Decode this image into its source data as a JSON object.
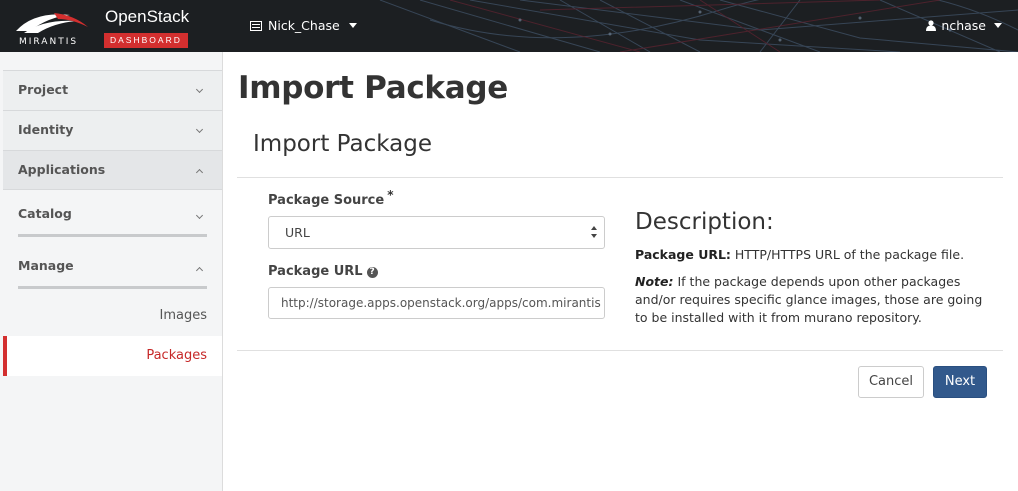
{
  "topbar": {
    "logo_openstack": "OpenStack",
    "logo_dashboard": "DASHBOARD",
    "logo_mirantis": "MIRANTIS",
    "project": "Nick_Chase",
    "user": "nchase"
  },
  "sidebar": {
    "project": "Project",
    "identity": "Identity",
    "applications": "Applications",
    "catalog": "Catalog",
    "manage": "Manage",
    "images": "Images",
    "packages": "Packages"
  },
  "main": {
    "page_title": "Import Package",
    "modal_title": "Import Package",
    "package_source_label": "Package Source",
    "required_mark": "*",
    "package_source_value": "URL",
    "package_url_label": "Package URL",
    "package_url_value": "http://storage.apps.openstack.org/apps/com.mirantis",
    "description_title": "Description:",
    "desc_url_term": "Package URL:",
    "desc_url_text": " HTTP/HTTPS URL of the package file.",
    "desc_note_term": "Note:",
    "desc_note_text": " If the package depends upon other packages and/or requires specific glance images, those are going to be installed with it from murano repository.",
    "cancel_label": "Cancel",
    "next_label": "Next"
  },
  "colors": {
    "accent_red": "#d32f2f",
    "primary_button": "#32598c",
    "topbar": "#1c1f22"
  }
}
